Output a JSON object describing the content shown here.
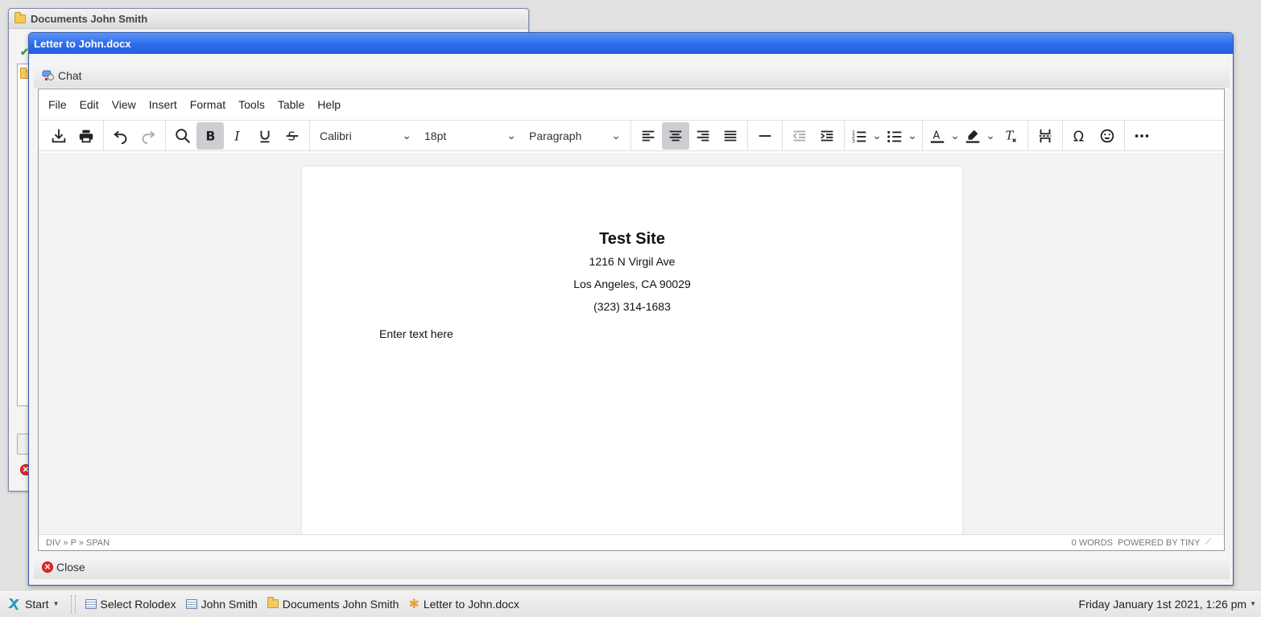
{
  "background_window": {
    "title": "Documents John Smith"
  },
  "window": {
    "title": "Letter to John.docx",
    "chat_label": "Chat",
    "close_label": "Close"
  },
  "menu": [
    "File",
    "Edit",
    "View",
    "Insert",
    "Format",
    "Tools",
    "Table",
    "Help"
  ],
  "toolbar": {
    "font_family": "Calibri",
    "font_size": "18pt",
    "block_format": "Paragraph",
    "bold_active": true,
    "align_center_active": true
  },
  "document": {
    "title": "Test Site",
    "address_line": "1216 N Virgil Ave",
    "city_line": "Los Angeles, CA 90029",
    "phone_line": "(323) 314-1683",
    "body_text": "Enter text here"
  },
  "statusbar": {
    "path": "DIV » P » SPAN",
    "word_count": "0 WORDS",
    "powered_by": "POWERED BY TINY"
  },
  "taskbar": {
    "start_label": "Start",
    "tasks": [
      "Select Rolodex",
      "John Smith",
      "Documents John Smith",
      "Letter to John.docx"
    ],
    "clock": "Friday January 1st 2021, 1:26 pm"
  },
  "colors": {
    "titlebar_blue": "#2c6bed",
    "active_button": "#ccced2",
    "close_red": "#e02a2a"
  }
}
